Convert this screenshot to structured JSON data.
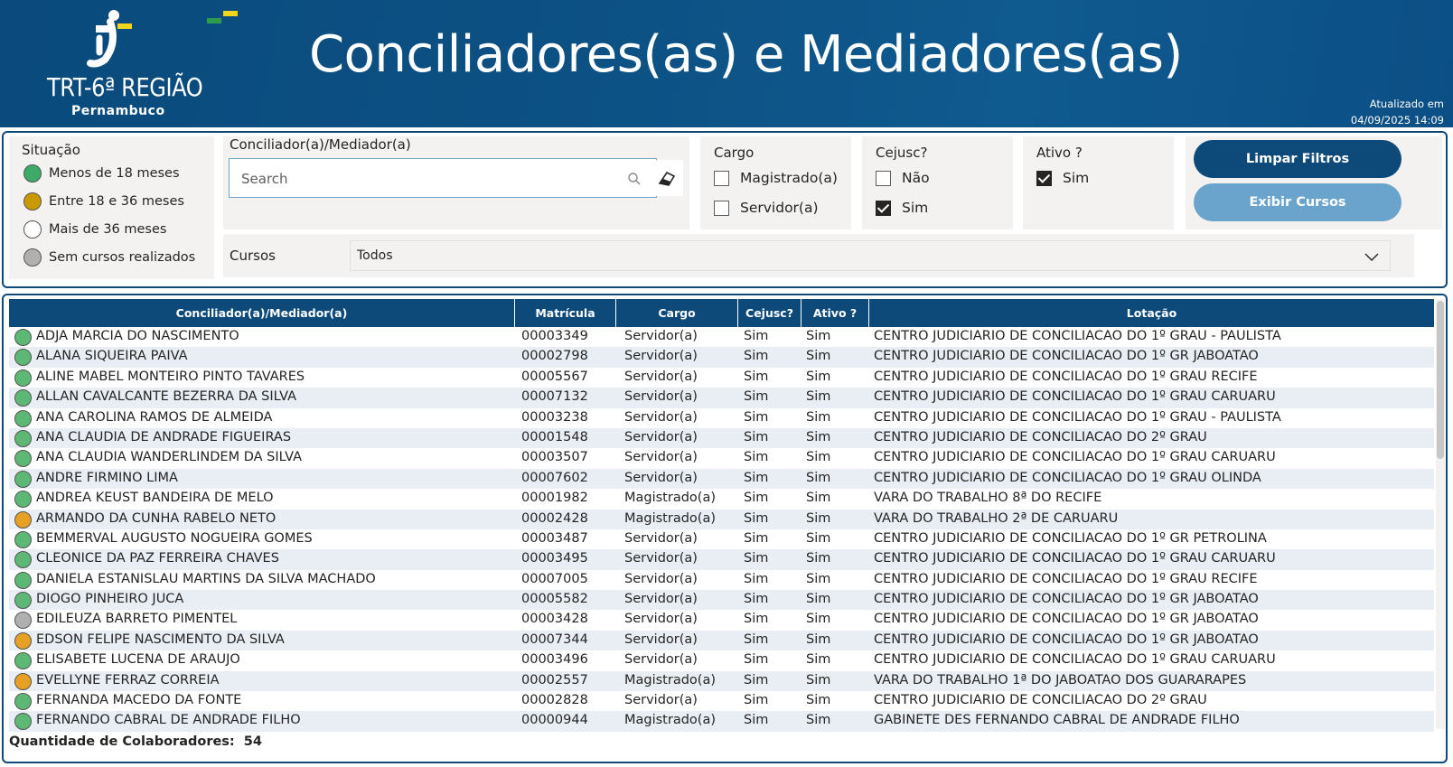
{
  "header": {
    "org_name": "TRT-6ª REGIÃO",
    "org_sub": "Pernambuco",
    "title": "Conciliadores(as) e Mediadores(as)",
    "updated_label": "Atualizado em",
    "updated_value": "04/09/2025 14:09"
  },
  "colors": {
    "header_bg": "#0d4a7a",
    "green": "#4caf6a",
    "gold": "#c89a00",
    "orange": "#e6a023",
    "gray": "#b0b0b0",
    "white": "#ffffff"
  },
  "legend": {
    "title": "Situação",
    "items": [
      {
        "label": "Menos de 18 meses",
        "color": "#3daa6a"
      },
      {
        "label": "Entre 18 e 36 meses",
        "color": "#c89a00"
      },
      {
        "label": "Mais de 36 meses",
        "color": "#ffffff"
      },
      {
        "label": "Sem cursos realizados",
        "color": "#b0b0b0"
      }
    ]
  },
  "search": {
    "label": "Conciliador(a)/Mediador(a)",
    "placeholder": "Search"
  },
  "cargo": {
    "label": "Cargo",
    "options": [
      {
        "label": "Magistrado(a)",
        "checked": false
      },
      {
        "label": "Servidor(a)",
        "checked": false
      }
    ]
  },
  "cejusc": {
    "label": "Cejusc?",
    "options": [
      {
        "label": "Não",
        "checked": false
      },
      {
        "label": "Sim",
        "checked": true
      }
    ]
  },
  "ativo": {
    "label": "Ativo ?",
    "options": [
      {
        "label": "Sim",
        "checked": true
      }
    ]
  },
  "buttons": {
    "clear": "Limpar Filtros",
    "courses": "Exibir Cursos"
  },
  "cursos": {
    "label": "Cursos",
    "value": "Todos"
  },
  "table": {
    "columns": [
      "Conciliador(a)/Mediador(a)",
      "Matrícula",
      "Cargo",
      "Cejusc?",
      "Ativo ?",
      "Lotação"
    ],
    "rows": [
      {
        "status": "#5cb874",
        "name": "ADJA MARCIA DO NASCIMENTO",
        "matricula": "00003349",
        "cargo": "Servidor(a)",
        "cejusc": "Sim",
        "ativo": "Sim",
        "lotacao": "CENTRO JUDICIARIO DE CONCILIACAO DO 1º GRAU - PAULISTA"
      },
      {
        "status": "#5cb874",
        "name": "ALANA SIQUEIRA PAIVA",
        "matricula": "00002798",
        "cargo": "Servidor(a)",
        "cejusc": "Sim",
        "ativo": "Sim",
        "lotacao": "CENTRO JUDICIARIO DE CONCILIACAO DO 1º GR JABOATAO"
      },
      {
        "status": "#5cb874",
        "name": "ALINE MABEL MONTEIRO PINTO TAVARES",
        "matricula": "00005567",
        "cargo": "Servidor(a)",
        "cejusc": "Sim",
        "ativo": "Sim",
        "lotacao": "CENTRO JUDICIARIO DE CONCILIACAO DO 1º GRAU RECIFE"
      },
      {
        "status": "#5cb874",
        "name": "ALLAN CAVALCANTE BEZERRA DA SILVA",
        "matricula": "00007132",
        "cargo": "Servidor(a)",
        "cejusc": "Sim",
        "ativo": "Sim",
        "lotacao": "CENTRO JUDICIARIO DE CONCILIACAO DO 1º GRAU CARUARU"
      },
      {
        "status": "#5cb874",
        "name": "ANA CAROLINA RAMOS DE ALMEIDA",
        "matricula": "00003238",
        "cargo": "Servidor(a)",
        "cejusc": "Sim",
        "ativo": "Sim",
        "lotacao": "CENTRO JUDICIARIO DE CONCILIACAO DO 1º GRAU - PAULISTA"
      },
      {
        "status": "#5cb874",
        "name": "ANA CLAUDIA DE ANDRADE FIGUEIRAS",
        "matricula": "00001548",
        "cargo": "Servidor(a)",
        "cejusc": "Sim",
        "ativo": "Sim",
        "lotacao": "CENTRO JUDICIARIO DE CONCILIACAO DO 2º GRAU"
      },
      {
        "status": "#5cb874",
        "name": "ANA CLAUDIA WANDERLINDEM DA SILVA",
        "matricula": "00003507",
        "cargo": "Servidor(a)",
        "cejusc": "Sim",
        "ativo": "Sim",
        "lotacao": "CENTRO JUDICIARIO DE CONCILIACAO DO 1º GRAU CARUARU"
      },
      {
        "status": "#5cb874",
        "name": "ANDRE FIRMINO LIMA",
        "matricula": "00007602",
        "cargo": "Servidor(a)",
        "cejusc": "Sim",
        "ativo": "Sim",
        "lotacao": "CENTRO JUDICIARIO DE CONCILIACAO DO 1º GRAU OLINDA"
      },
      {
        "status": "#5cb874",
        "name": "ANDREA KEUST BANDEIRA DE MELO",
        "matricula": "00001982",
        "cargo": "Magistrado(a)",
        "cejusc": "Sim",
        "ativo": "Sim",
        "lotacao": "VARA DO TRABALHO 8ª DO RECIFE"
      },
      {
        "status": "#e6a023",
        "name": "ARMANDO DA CUNHA RABELO NETO",
        "matricula": "00002428",
        "cargo": "Magistrado(a)",
        "cejusc": "Sim",
        "ativo": "Sim",
        "lotacao": "VARA DO TRABALHO 2ª DE CARUARU"
      },
      {
        "status": "#5cb874",
        "name": "BEMMERVAL AUGUSTO NOGUEIRA GOMES",
        "matricula": "00003487",
        "cargo": "Servidor(a)",
        "cejusc": "Sim",
        "ativo": "Sim",
        "lotacao": "CENTRO JUDICIARIO DE CONCILIACAO DO 1º GR PETROLINA"
      },
      {
        "status": "#5cb874",
        "name": "CLEONICE DA PAZ FERREIRA CHAVES",
        "matricula": "00003495",
        "cargo": "Servidor(a)",
        "cejusc": "Sim",
        "ativo": "Sim",
        "lotacao": "CENTRO JUDICIARIO DE CONCILIACAO DO 1º GRAU CARUARU"
      },
      {
        "status": "#5cb874",
        "name": "DANIELA ESTANISLAU MARTINS DA SILVA MACHADO",
        "matricula": "00007005",
        "cargo": "Servidor(a)",
        "cejusc": "Sim",
        "ativo": "Sim",
        "lotacao": "CENTRO JUDICIARIO DE CONCILIACAO DO 1º GRAU RECIFE"
      },
      {
        "status": "#5cb874",
        "name": "DIOGO PINHEIRO JUCA",
        "matricula": "00005582",
        "cargo": "Servidor(a)",
        "cejusc": "Sim",
        "ativo": "Sim",
        "lotacao": "CENTRO JUDICIARIO DE CONCILIACAO DO 1º GR JABOATAO"
      },
      {
        "status": "#b0b0b0",
        "name": "EDILEUZA BARRETO PIMENTEL",
        "matricula": "00003428",
        "cargo": "Servidor(a)",
        "cejusc": "Sim",
        "ativo": "Sim",
        "lotacao": "CENTRO JUDICIARIO DE CONCILIACAO DO 1º GR JABOATAO"
      },
      {
        "status": "#e6a023",
        "name": "EDSON FELIPE NASCIMENTO DA SILVA",
        "matricula": "00007344",
        "cargo": "Servidor(a)",
        "cejusc": "Sim",
        "ativo": "Sim",
        "lotacao": "CENTRO JUDICIARIO DE CONCILIACAO DO 1º GR JABOATAO"
      },
      {
        "status": "#5cb874",
        "name": "ELISABETE LUCENA DE ARAUJO",
        "matricula": "00003496",
        "cargo": "Servidor(a)",
        "cejusc": "Sim",
        "ativo": "Sim",
        "lotacao": "CENTRO JUDICIARIO DE CONCILIACAO DO 1º GRAU CARUARU"
      },
      {
        "status": "#e6a023",
        "name": "EVELLYNE FERRAZ CORREIA",
        "matricula": "00002557",
        "cargo": "Magistrado(a)",
        "cejusc": "Sim",
        "ativo": "Sim",
        "lotacao": "VARA DO TRABALHO 1ª DO JABOATAO DOS GUARARAPES"
      },
      {
        "status": "#5cb874",
        "name": "FERNANDA MACEDO DA FONTE",
        "matricula": "00002828",
        "cargo": "Servidor(a)",
        "cejusc": "Sim",
        "ativo": "Sim",
        "lotacao": "CENTRO JUDICIARIO DE CONCILIACAO DO 2º GRAU"
      },
      {
        "status": "#5cb874",
        "name": "FERNANDO CABRAL DE ANDRADE FILHO",
        "matricula": "00000944",
        "cargo": "Magistrado(a)",
        "cejusc": "Sim",
        "ativo": "Sim",
        "lotacao": "GABINETE DES FERNANDO CABRAL DE ANDRADE FILHO"
      }
    ],
    "total_label": "Quantidade de Colaboradores:",
    "total_value": "54"
  }
}
